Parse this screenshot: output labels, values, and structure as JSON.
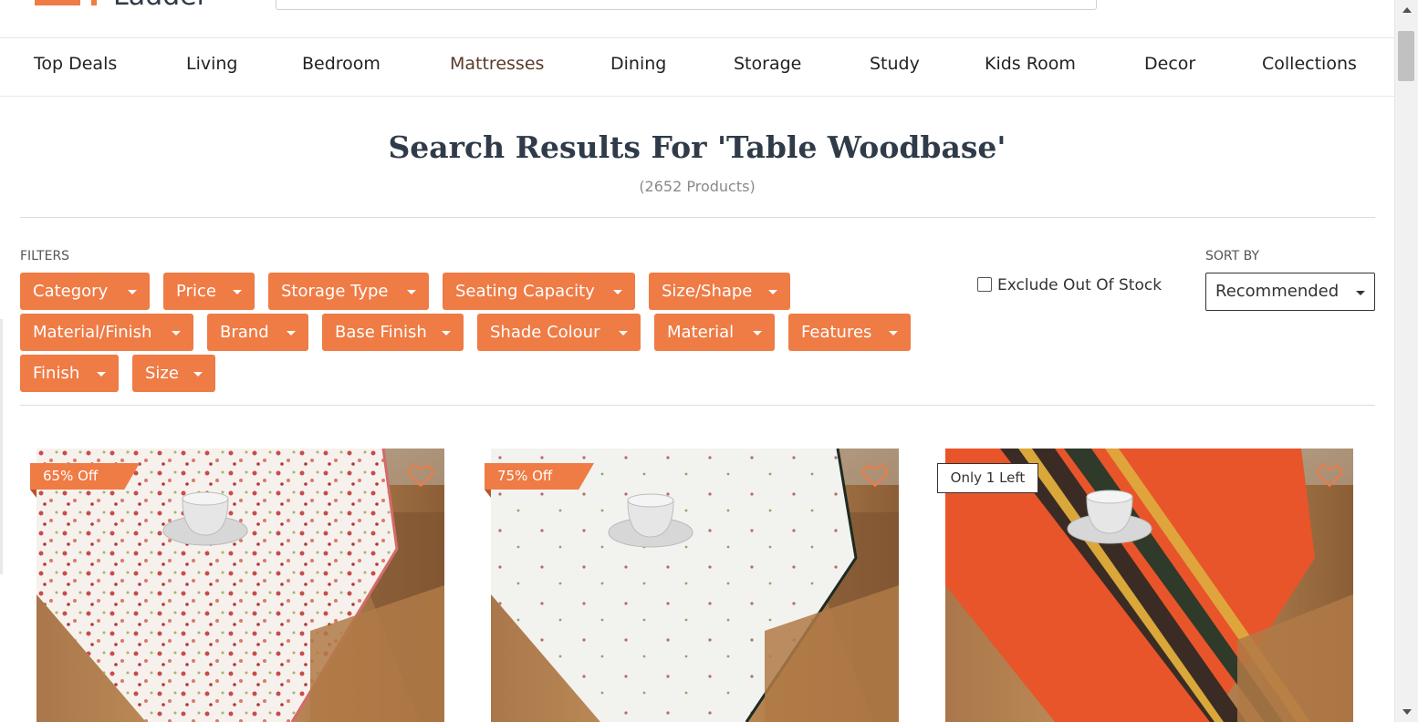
{
  "header": {
    "logo_text": "Ladder",
    "brand_color": "#ef7b45"
  },
  "nav": {
    "items": [
      "Top Deals",
      "Living",
      "Bedroom",
      "Mattresses",
      "Dining",
      "Storage",
      "Study",
      "Kids Room",
      "Decor",
      "Collections"
    ],
    "active": "Mattresses"
  },
  "results": {
    "title": "Search Results For 'Table Woodbase'",
    "count": "(2652 Products)"
  },
  "filters": {
    "label": "FILTERS",
    "chips": [
      "Category",
      "Price",
      "Storage Type",
      "Seating Capacity",
      "Size/Shape",
      "Material/Finish",
      "Brand",
      "Base Finish",
      "Shade Colour",
      "Material",
      "Features",
      "Finish",
      "Size"
    ],
    "exclude_out_of_stock": {
      "label": "Exclude Out Of Stock",
      "checked": false
    }
  },
  "sort": {
    "label": "SORT BY",
    "selected": "Recommended"
  },
  "products": [
    {
      "badge": "65% Off",
      "runner_color": "#f6f1ec",
      "pattern": "floral-red"
    },
    {
      "badge": "75% Off",
      "runner_color": "#f2f2ef",
      "pattern": "sparse-sprigs"
    },
    {
      "badge": "Only 1 Left",
      "runner_color": "#e8552a",
      "pattern": "stripes"
    }
  ],
  "icons": {
    "wishlist": "heart-outline-icon",
    "dropdown": "caret-down-icon"
  }
}
